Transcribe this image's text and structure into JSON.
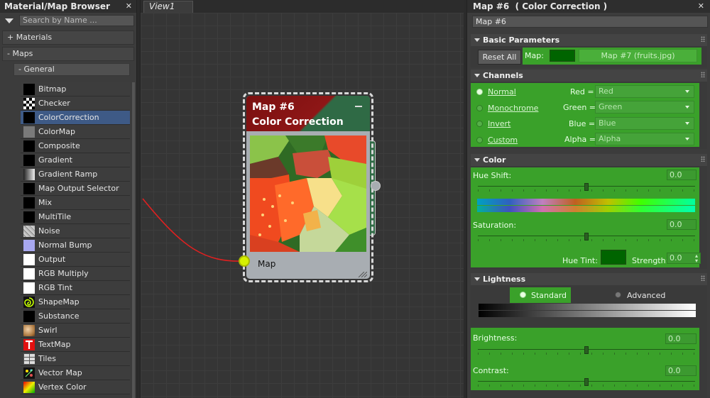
{
  "browser": {
    "title": "Material/Map Browser",
    "search_placeholder": "Search by Name ...",
    "materials_label": "+ Materials",
    "maps_label": "- Maps",
    "general_label": "- General",
    "maps": [
      {
        "label": "Bitmap",
        "icon": "bitmap-icon"
      },
      {
        "label": "Checker",
        "icon": "checker-icon"
      },
      {
        "label": "ColorCorrection",
        "icon": "colorcorrection-icon",
        "selected": true
      },
      {
        "label": "ColorMap",
        "icon": "colormap-icon"
      },
      {
        "label": "Composite",
        "icon": "composite-icon"
      },
      {
        "label": "Gradient",
        "icon": "gradient-icon"
      },
      {
        "label": "Gradient Ramp",
        "icon": "gradient-ramp-icon"
      },
      {
        "label": "Map Output Selector",
        "icon": "map-output-selector-icon"
      },
      {
        "label": "Mix",
        "icon": "mix-icon"
      },
      {
        "label": "MultiTile",
        "icon": "multitile-icon"
      },
      {
        "label": "Noise",
        "icon": "noise-icon"
      },
      {
        "label": "Normal Bump",
        "icon": "normal-bump-icon"
      },
      {
        "label": "Output",
        "icon": "output-icon"
      },
      {
        "label": "RGB Multiply",
        "icon": "rgb-multiply-icon"
      },
      {
        "label": "RGB Tint",
        "icon": "rgb-tint-icon"
      },
      {
        "label": "ShapeMap",
        "icon": "shapemap-icon"
      },
      {
        "label": "Substance",
        "icon": "substance-icon"
      },
      {
        "label": "Swirl",
        "icon": "swirl-icon"
      },
      {
        "label": "TextMap",
        "icon": "textmap-icon"
      },
      {
        "label": "Tiles",
        "icon": "tiles-icon"
      },
      {
        "label": "Vector Map",
        "icon": "vector-map-icon"
      },
      {
        "label": "Vertex Color",
        "icon": "vertex-color-icon"
      }
    ]
  },
  "view": {
    "tab_label": "View1",
    "node": {
      "title1": "Map #6",
      "title2": "Color Correction",
      "port_label": "Map",
      "header_color": "#8e1616",
      "accent_color": "#2f6a45"
    }
  },
  "panel": {
    "title": "Map #6  ( Color Correction )",
    "name_value": "Map #6",
    "basic": {
      "header": "Basic Parameters",
      "reset_label": "Reset All",
      "map_label": "Map:",
      "map_button": "Map #7 (fruits.jpg)",
      "map_swatch_color": "#006400"
    },
    "channels": {
      "header": "Channels",
      "modes": [
        "Normal",
        "Monochrome",
        "Invert",
        "Custom"
      ],
      "selected_mode": "Normal",
      "rows": [
        {
          "label": "Red =",
          "value": "Red"
        },
        {
          "label": "Green =",
          "value": "Green"
        },
        {
          "label": "Blue =",
          "value": "Blue"
        },
        {
          "label": "Alpha =",
          "value": "Alpha"
        }
      ]
    },
    "color": {
      "header": "Color",
      "hue_shift_label": "Hue Shift:",
      "hue_shift_value": "0.0",
      "hue_shift_slider": 0.5,
      "saturation_label": "Saturation:",
      "saturation_value": "0.0",
      "saturation_slider": 0.5,
      "hue_tint_label": "Hue Tint:",
      "hue_tint_color": "#006400",
      "strength_label": "Strength:",
      "strength_value": "0.0"
    },
    "lightness": {
      "header": "Lightness",
      "standard_label": "Standard",
      "advanced_label": "Advanced",
      "selected": "Standard",
      "brightness_label": "Brightness:",
      "brightness_value": "0.0",
      "brightness_slider": 0.5,
      "contrast_label": "Contrast:",
      "contrast_value": "0.0",
      "contrast_slider": 0.5
    },
    "green_accent": "#3aa12a"
  }
}
